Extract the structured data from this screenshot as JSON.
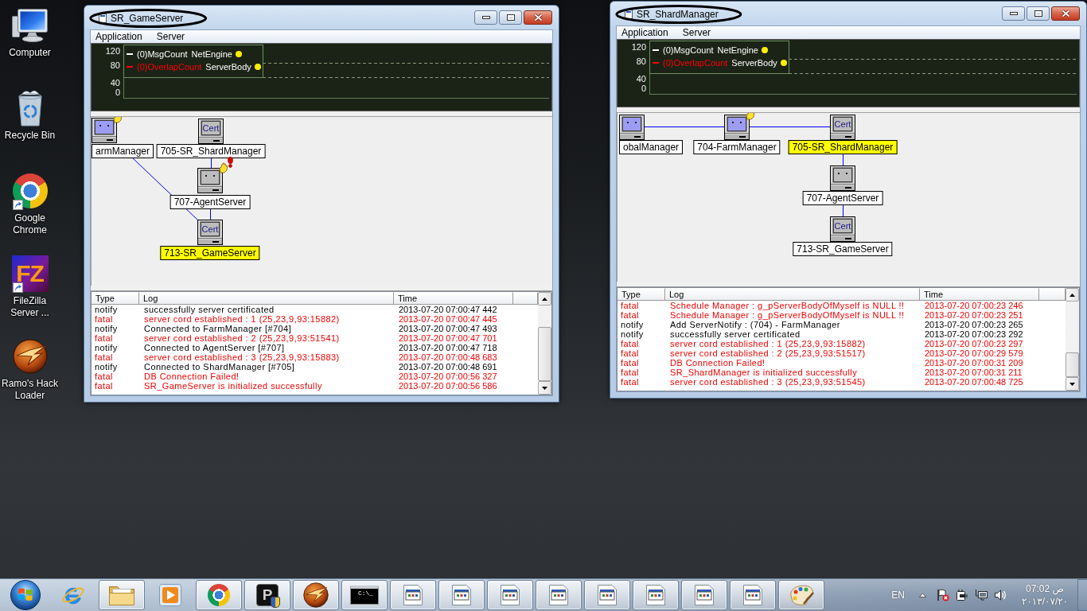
{
  "desktop_icons": [
    {
      "label": "Computer",
      "kind": "computer",
      "shortcut": false
    },
    {
      "label": "Recycle Bin",
      "kind": "recycle_bin",
      "shortcut": false
    },
    {
      "label": "Google Chrome",
      "kind": "chrome",
      "shortcut": true
    },
    {
      "label": "FileZilla Server ...",
      "kind": "filezilla",
      "logo_text": "FZ",
      "shortcut": true
    },
    {
      "label": "Ramo's Hack Loader",
      "kind": "emblem",
      "shortcut": false
    }
  ],
  "windows": [
    {
      "title": "SR_GameServer",
      "circled": true,
      "menu": [
        "Application",
        "Server"
      ],
      "graph": {
        "y_labels": [
          "120",
          "80",
          "40",
          "0"
        ],
        "legend": [
          {
            "label": "(0)MsgCount",
            "source": "NetEngine",
            "color": "#ffffff"
          },
          {
            "label": "(0)OverlapCount",
            "source": "ServerBody",
            "color": "#ff0000"
          }
        ]
      },
      "diagram": {
        "nodes": [
          {
            "label": "armManager",
            "kind": "active",
            "waving": true,
            "alert": false,
            "highlighted": false
          },
          {
            "label": "705-SR_ShardManager",
            "kind": "cert",
            "screen_text": "Cert",
            "waving": false,
            "alert": false,
            "highlighted": false
          },
          {
            "label": "707-AgentServer",
            "kind": "idle",
            "waving": true,
            "alert": true,
            "highlighted": false
          },
          {
            "label": "713-SR_GameServer",
            "kind": "cert",
            "screen_text": "Cert",
            "waving": false,
            "alert": false,
            "highlighted": true
          }
        ]
      },
      "log": {
        "columns": [
          "Type",
          "Log",
          "Time"
        ],
        "rows": [
          {
            "type": "notify",
            "message": "successfully server certificated",
            "time": "2013-07-20 07:00:47 442",
            "error": false
          },
          {
            "type": "fatal",
            "message": "server cord established : 1 (25,23,9,93:15882)",
            "time": "2013-07-20 07:00:47 445",
            "error": true
          },
          {
            "type": "notify",
            "message": "Connected to FarmManager [#704]",
            "time": "2013-07-20 07:00:47 493",
            "error": false
          },
          {
            "type": "fatal",
            "message": "server cord established : 2 (25,23,9,93:51541)",
            "time": "2013-07-20 07:00:47 701",
            "error": true
          },
          {
            "type": "notify",
            "message": "Connected to AgentServer [#707]",
            "time": "2013-07-20 07:00:47 718",
            "error": false
          },
          {
            "type": "fatal",
            "message": "server cord established : 3 (25,23,9,93:15883)",
            "time": "2013-07-20 07:00:48 683",
            "error": true
          },
          {
            "type": "notify",
            "message": "Connected to ShardManager [#705]",
            "time": "2013-07-20 07:00:48 691",
            "error": false
          },
          {
            "type": "fatal",
            "message": "DB Connection Failed!",
            "time": "2013-07-20 07:00:56 327",
            "error": true
          },
          {
            "type": "fatal",
            "message": "SR_GameServer is initialized successfully",
            "time": "2013-07-20 07:00:56 586",
            "error": true
          }
        ]
      }
    },
    {
      "title": "SR_ShardManager",
      "circled": true,
      "menu": [
        "Application",
        "Server"
      ],
      "graph": {
        "y_labels": [
          "120",
          "80",
          "40",
          "0"
        ],
        "legend": [
          {
            "label": "(0)MsgCount",
            "source": "NetEngine",
            "color": "#ffffff"
          },
          {
            "label": "(0)OverlapCount",
            "source": "ServerBody",
            "color": "#ff0000"
          }
        ]
      },
      "diagram": {
        "nodes": [
          {
            "label": "obalManager",
            "kind": "active",
            "waving": false,
            "alert": false,
            "highlighted": false
          },
          {
            "label": "704-FarmManager",
            "kind": "active",
            "waving": true,
            "alert": false,
            "highlighted": false
          },
          {
            "label": "705-SR_ShardManager",
            "kind": "cert",
            "screen_text": "Cert",
            "waving": false,
            "alert": false,
            "highlighted": true
          },
          {
            "label": "707-AgentServer",
            "kind": "idle",
            "waving": false,
            "alert": false,
            "highlighted": false
          },
          {
            "label": "713-SR_GameServer",
            "kind": "cert",
            "screen_text": "Cert",
            "waving": false,
            "alert": false,
            "highlighted": false
          }
        ]
      },
      "log": {
        "columns": [
          "Type",
          "Log",
          "Time"
        ],
        "rows": [
          {
            "type": "fatal",
            "message": "Schedule Manager : g_pServerBodyOfMyself is NULL !!",
            "time": "2013-07-20 07:00:23 246",
            "error": true
          },
          {
            "type": "fatal",
            "message": "Schedule Manager : g_pServerBodyOfMyself is NULL !!",
            "time": "2013-07-20 07:00:23 251",
            "error": true
          },
          {
            "type": "notify",
            "message": "Add ServerNotify : (704) - FarmManager",
            "time": "2013-07-20 07:00:23 265",
            "error": false
          },
          {
            "type": "notify",
            "message": "successfully server certificated",
            "time": "2013-07-20 07:00:23 292",
            "error": false
          },
          {
            "type": "fatal",
            "message": "server cord established : 1 (25,23,9,93:15882)",
            "time": "2013-07-20 07:00:23 297",
            "error": true
          },
          {
            "type": "fatal",
            "message": "server cord established : 2 (25,23,9,93:51517)",
            "time": "2013-07-20 07:00:29 579",
            "error": true
          },
          {
            "type": "fatal",
            "message": "DB Connection Failed!",
            "time": "2013-07-20 07:00:31 209",
            "error": true
          },
          {
            "type": "fatal",
            "message": "SR_ShardManager is initialized successfully",
            "time": "2013-07-20 07:00:31 211",
            "error": true
          },
          {
            "type": "fatal",
            "message": "server cord established : 3 (25,23,9,93:51545)",
            "time": "2013-07-20 07:00:48 725",
            "error": true
          }
        ]
      }
    }
  ],
  "taskbar": {
    "items": [
      {
        "kind": "ie",
        "running": false
      },
      {
        "kind": "folder",
        "running": true
      },
      {
        "kind": "media",
        "running": false
      },
      {
        "kind": "chrome",
        "running": true
      },
      {
        "kind": "p_app",
        "icon_text": "P",
        "running": true
      },
      {
        "kind": "emblem",
        "running": true
      },
      {
        "kind": "console",
        "icon_text": "C:\\_",
        "running": true
      },
      {
        "kind": "window",
        "running": true
      },
      {
        "kind": "window",
        "running": true
      },
      {
        "kind": "window",
        "running": true
      },
      {
        "kind": "window",
        "running": true
      },
      {
        "kind": "window",
        "running": true
      },
      {
        "kind": "window",
        "running": true
      },
      {
        "kind": "window",
        "running": true
      },
      {
        "kind": "window",
        "running": true
      },
      {
        "kind": "paint",
        "running": true
      }
    ],
    "tray": {
      "language": "EN",
      "time": "07:02 ص",
      "date": "٢٠١٣/٠٧/٢٠"
    }
  }
}
